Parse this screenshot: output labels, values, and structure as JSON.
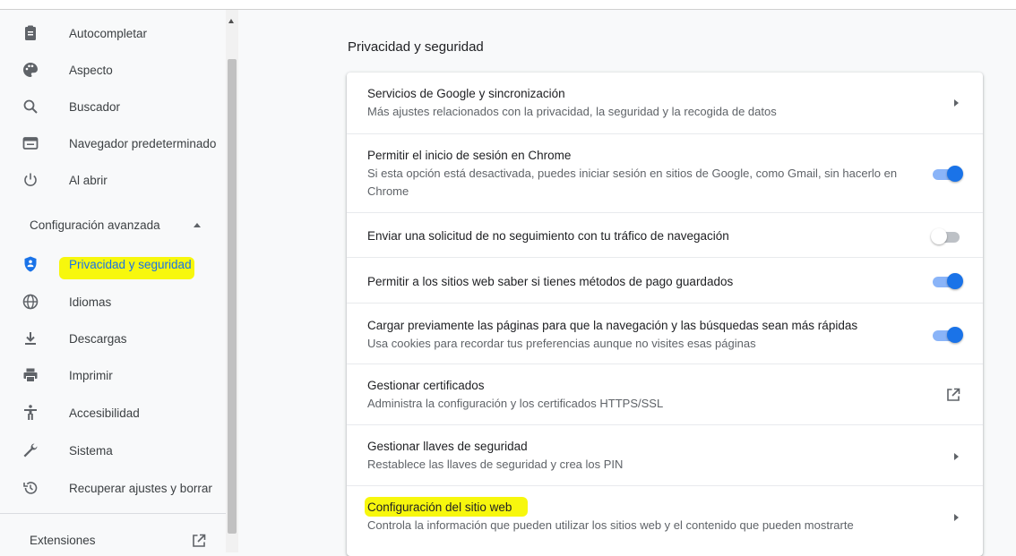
{
  "colors": {
    "accent": "#1a73e8",
    "highlight": "#f7f700",
    "text": "#202124",
    "secondary": "#5f6368"
  },
  "sidebar": {
    "items": [
      {
        "label": "Autocompletar",
        "icon": "clipboard-icon"
      },
      {
        "label": "Aspecto",
        "icon": "palette-icon"
      },
      {
        "label": "Buscador",
        "icon": "search-icon"
      },
      {
        "label": "Navegador predeterminado",
        "icon": "browser-icon"
      },
      {
        "label": "Al abrir",
        "icon": "power-icon"
      }
    ],
    "advanced_label": "Configuración avanzada",
    "advanced_items": [
      {
        "label": "Privacidad y seguridad",
        "icon": "shield-icon",
        "active": true
      },
      {
        "label": "Idiomas",
        "icon": "globe-icon"
      },
      {
        "label": "Descargas",
        "icon": "download-icon"
      },
      {
        "label": "Imprimir",
        "icon": "printer-icon"
      },
      {
        "label": "Accesibilidad",
        "icon": "accessibility-icon"
      },
      {
        "label": "Sistema",
        "icon": "wrench-icon"
      },
      {
        "label": "Recuperar ajustes y borrar",
        "icon": "restore-icon"
      }
    ],
    "extensions_label": "Extensiones"
  },
  "main": {
    "section_title": "Privacidad y seguridad",
    "rows": [
      {
        "title": "Servicios de Google y sincronización",
        "subtitle": "Más ajustes relacionados con la privacidad, la seguridad y la recogida de datos",
        "control": "arrow"
      },
      {
        "title": "Permitir el inicio de sesión en Chrome",
        "subtitle": "Si esta opción está desactivada, puedes iniciar sesión en sitios de Google, como Gmail, sin hacerlo en Chrome",
        "control": "toggle",
        "on": true
      },
      {
        "title": "Enviar una solicitud de no seguimiento con tu tráfico de navegación",
        "control": "toggle",
        "on": false
      },
      {
        "title": "Permitir a los sitios web saber si tienes métodos de pago guardados",
        "control": "toggle",
        "on": true
      },
      {
        "title": "Cargar previamente las páginas para que la navegación y las búsquedas sean más rápidas",
        "subtitle": "Usa cookies para recordar tus preferencias aunque no visites esas páginas",
        "control": "toggle",
        "on": true
      },
      {
        "title": "Gestionar certificados",
        "subtitle": "Administra la configuración y los certificados HTTPS/SSL",
        "control": "external-link"
      },
      {
        "title": "Gestionar llaves de seguridad",
        "subtitle": "Restablece las llaves de seguridad y crea los PIN",
        "control": "arrow"
      },
      {
        "title": "Configuración del sitio web",
        "subtitle": "Controla la información que pueden utilizar los sitios web y el contenido que pueden mostrarte",
        "control": "arrow"
      }
    ]
  }
}
